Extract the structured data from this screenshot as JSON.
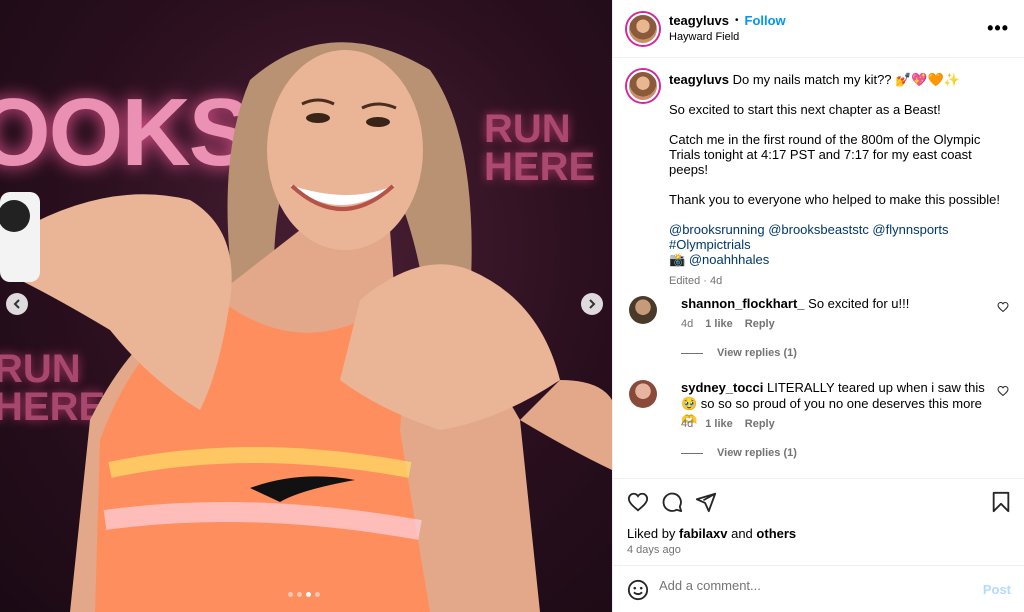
{
  "photo": {
    "brand_text": "OOKS",
    "sign_text": "RUN\nHERE",
    "sign_text_2": "RUN\nHERE",
    "dots": 4,
    "active_dot": 3
  },
  "header": {
    "username": "teagyluvs",
    "separator": "•",
    "follow_label": "Follow",
    "location": "Hayward Field",
    "more_label": "•••"
  },
  "caption": {
    "username": "teagyluvs",
    "line1": "Do my nails match my kit?? 💅💖🧡✨",
    "line2": "So excited to start this next chapter as a Beast!",
    "line3": "Catch me in the first round of the 800m of the Olympic Trials tonight at 4:17 PST and 7:17 for my east coast peeps!",
    "line4": "Thank you to everyone who helped to make this possible!",
    "mentions": "@brooksrunning @brooksbeaststc @flynnsports",
    "hashtag": "#Olympictrials",
    "camera": "📸",
    "photographer": "@noahhhales",
    "edited": "Edited · 4d"
  },
  "comments": [
    {
      "username": "shannon_flockhart_",
      "text": "So excited for u!!!",
      "age": "4d",
      "likes": "1 like",
      "reply_label": "Reply",
      "view_replies": "View replies (1)"
    },
    {
      "username": "sydney_tocci",
      "text": "LITERALLY teared up when i saw this 🥹 so so so proud of you no one deserves this more 🫶",
      "age": "4d",
      "likes": "1 like",
      "reply_label": "Reply",
      "view_replies": "View replies (1)"
    }
  ],
  "engagement": {
    "liked_prefix": "Liked by",
    "liked_user": "fabilaxv",
    "liked_and": "and",
    "liked_others": "others",
    "posted_ago": "4 days ago"
  },
  "add_comment": {
    "placeholder": "Add a comment...",
    "post_label": "Post"
  },
  "icons": {
    "like": "heart-icon",
    "comment": "comment-icon",
    "share": "share-icon",
    "save": "bookmark-icon",
    "emoji": "emoji-icon",
    "prev": "chevron-left-icon",
    "next": "chevron-right-icon"
  },
  "colors": {
    "accent": "#0095f6",
    "link": "#00376b",
    "muted": "#737373",
    "post_disabled": "#b3dbff"
  }
}
